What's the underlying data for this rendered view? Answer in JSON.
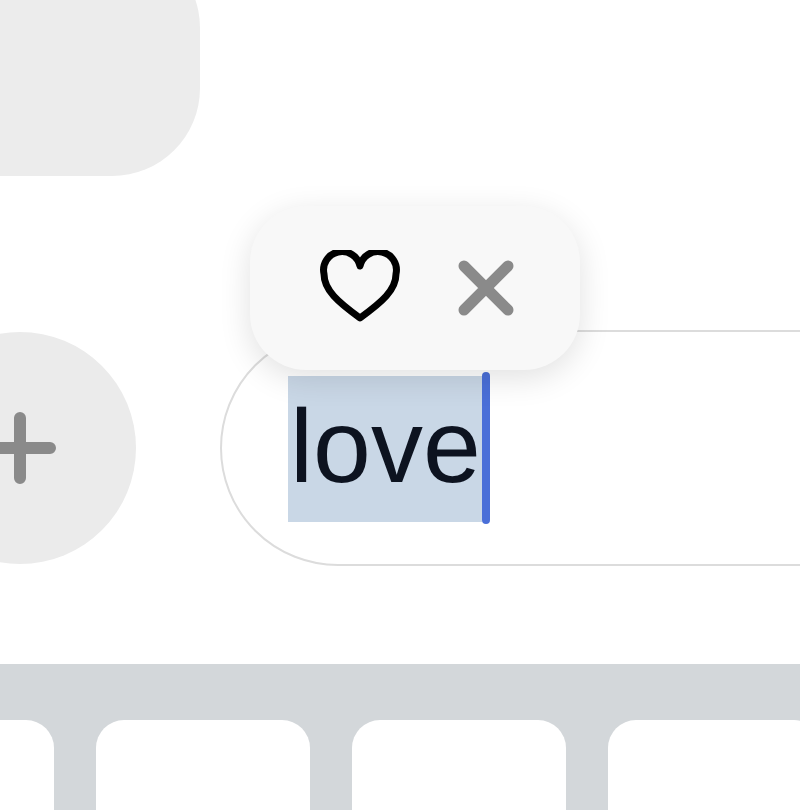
{
  "text_field": {
    "value": "love",
    "selected": true
  }
}
